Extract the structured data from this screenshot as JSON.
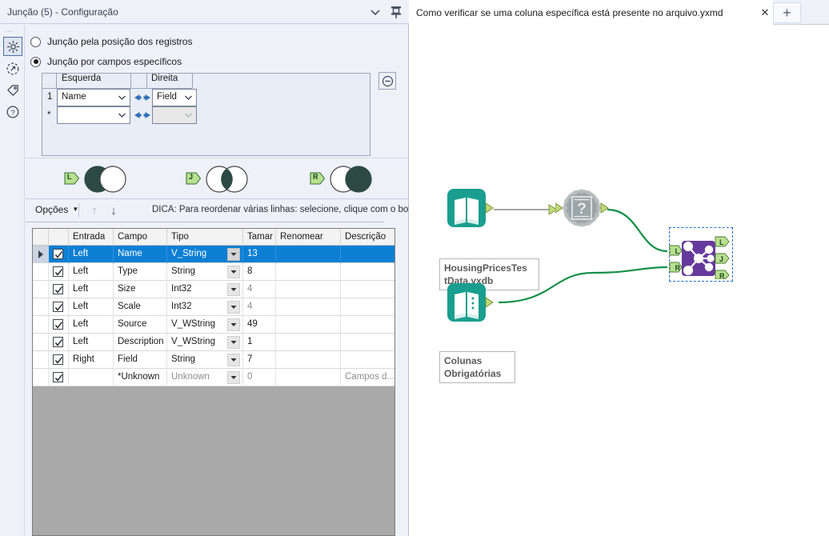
{
  "config_panel": {
    "title": "Junção (5) - Configuração",
    "rail": [
      {
        "name": "gear-icon",
        "label": "Configuração"
      },
      {
        "name": "runtime-icon",
        "label": "Tempo de execução"
      },
      {
        "name": "annotation-icon",
        "label": "Anotação"
      },
      {
        "name": "help-icon",
        "label": "Ajuda"
      }
    ],
    "join_mode": {
      "option_position": "Junção pela posição dos registros",
      "option_fields": "Junção por campos específicos",
      "selected": "fields"
    },
    "mapping": {
      "col_left": "Esquerda",
      "col_right": "Direita",
      "rows": [
        {
          "num": "1",
          "left": "Name",
          "right": "Field",
          "right_enabled": true
        },
        {
          "num": "*",
          "left": "",
          "right": "",
          "right_enabled": false
        }
      ],
      "remove_button": "remove-join-row"
    },
    "outputs": [
      {
        "tag": "L",
        "name": "left-only-output"
      },
      {
        "tag": "J",
        "name": "join-output"
      },
      {
        "tag": "R",
        "name": "right-only-output"
      }
    ],
    "toolbar": {
      "options_label": "Opções",
      "move_up": "↑",
      "move_down": "↓",
      "hint": "DICA: Para reordenar várias linhas: selecione, clique com o botã"
    },
    "grid": {
      "headers": [
        "Entrada",
        "Campo",
        "Tipo",
        "Tamar",
        "Renomear",
        "Descrição"
      ],
      "rows": [
        {
          "checked": true,
          "selected": true,
          "entrada": "Left",
          "campo": "Name",
          "tipo": "V_String",
          "tipo_muted": false,
          "tamanho": "13",
          "tam_muted": false,
          "renomear": "",
          "descricao": ""
        },
        {
          "checked": true,
          "selected": false,
          "entrada": "Left",
          "campo": "Type",
          "tipo": "String",
          "tipo_muted": false,
          "tamanho": "8",
          "tam_muted": false,
          "renomear": "",
          "descricao": ""
        },
        {
          "checked": true,
          "selected": false,
          "entrada": "Left",
          "campo": "Size",
          "tipo": "Int32",
          "tipo_muted": false,
          "tamanho": "4",
          "tam_muted": true,
          "renomear": "",
          "descricao": ""
        },
        {
          "checked": true,
          "selected": false,
          "entrada": "Left",
          "campo": "Scale",
          "tipo": "Int32",
          "tipo_muted": false,
          "tamanho": "4",
          "tam_muted": true,
          "renomear": "",
          "descricao": ""
        },
        {
          "checked": true,
          "selected": false,
          "entrada": "Left",
          "campo": "Source",
          "tipo": "V_WString",
          "tipo_muted": false,
          "tamanho": "49",
          "tam_muted": false,
          "renomear": "",
          "descricao": ""
        },
        {
          "checked": true,
          "selected": false,
          "entrada": "Left",
          "campo": "Description",
          "tipo": "V_WString",
          "tipo_muted": false,
          "tamanho": "1",
          "tam_muted": false,
          "renomear": "",
          "descricao": ""
        },
        {
          "checked": true,
          "selected": false,
          "entrada": "Right",
          "campo": "Field",
          "tipo": "String",
          "tipo_muted": false,
          "tamanho": "7",
          "tam_muted": false,
          "renomear": "",
          "descricao": ""
        },
        {
          "checked": true,
          "selected": false,
          "entrada": "",
          "campo": "*Unknown",
          "tipo": "Unknown",
          "tipo_muted": true,
          "tamanho": "0",
          "tam_muted": true,
          "renomear": "",
          "descricao": "Campos d..."
        }
      ]
    }
  },
  "workspace": {
    "tab_title": "Como verificar se uma coluna específica está presente no arquivo.yxmd",
    "tab_close": "✕",
    "new_tab": "+",
    "nodes": [
      {
        "id": "input-housing",
        "type": "input-data-tool",
        "label": "HousingPricesTes\ntData.yxdb",
        "color": "#1a9e8f"
      },
      {
        "id": "field-info",
        "type": "field-info-tool",
        "label": "",
        "color": "#9aa3a6"
      },
      {
        "id": "input-colunas",
        "type": "text-input-tool",
        "label": "Colunas\nObrigatórias",
        "color": "#1a9e8f"
      },
      {
        "id": "join-tool",
        "type": "join-tool",
        "label": "",
        "color": "#663a9c",
        "selected": true,
        "anchors_in": [
          "L",
          "R"
        ],
        "anchors_out": [
          "L",
          "J",
          "R"
        ]
      }
    ]
  },
  "colors": {
    "panel_bg": "#eef1f8",
    "selection_blue": "#0c7fd4",
    "grid_empty": "#a9a9a9",
    "tool_teal": "#1a9e8f",
    "tool_purple": "#663a9c",
    "anchor_green": "#b4d45a",
    "connection_green": "#2c9a4a",
    "connection_gray": "#a6a6a6"
  }
}
